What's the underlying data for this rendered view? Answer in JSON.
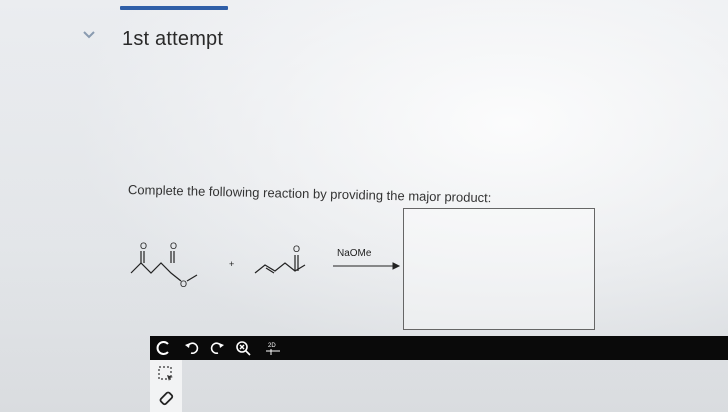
{
  "attempt": {
    "title": "1st attempt"
  },
  "question": {
    "prompt": "Complete the following reaction by providing the major product:",
    "reagent": "NaOMe",
    "reactant_plus": "+"
  },
  "toolbar": {
    "tools": [
      {
        "icon": "clear-icon"
      },
      {
        "icon": "undo-icon"
      },
      {
        "icon": "redo-icon"
      },
      {
        "icon": "zoom-icon"
      },
      {
        "icon": "2d-template-icon",
        "label": "2D"
      }
    ]
  },
  "side_tools": [
    {
      "icon": "selection-icon"
    },
    {
      "icon": "eraser-icon"
    }
  ],
  "colors": {
    "accent": "#2f5fa8",
    "toolbar_bg": "#0a0a0a"
  }
}
